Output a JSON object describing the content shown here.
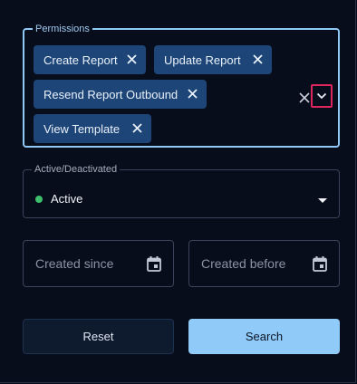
{
  "permissions": {
    "label": "Permissions",
    "chips": [
      {
        "label": "Create Report"
      },
      {
        "label": "Update Report"
      },
      {
        "label": "Resend Report Outbound"
      },
      {
        "label": "View Template"
      }
    ]
  },
  "status": {
    "label": "Active/Deactivated",
    "value": "Active",
    "status_color": "#3fbf6b"
  },
  "dates": {
    "since_placeholder": "Created since",
    "before_placeholder": "Created before"
  },
  "actions": {
    "reset_label": "Reset",
    "search_label": "Search"
  },
  "icons": {
    "chip_remove": "close-icon",
    "clear_all": "close-icon",
    "open_dropdown": "chevron-down-icon",
    "select_caret": "caret-down-icon",
    "date_picker": "calendar-icon"
  },
  "colors": {
    "background": "#080d1b",
    "chip": "#1d4577",
    "focus_border": "#8fc8f6",
    "dropdown_highlight": "#e0245e",
    "primary_button": "#90caf9"
  }
}
